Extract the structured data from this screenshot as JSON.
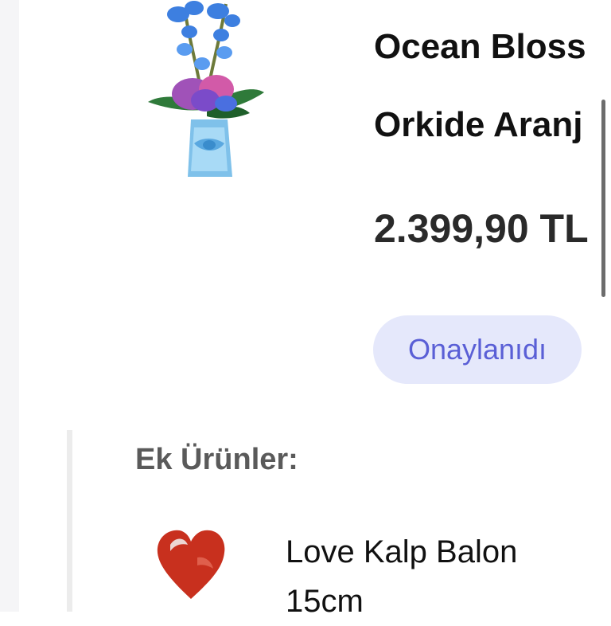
{
  "product": {
    "title_line1": "Ocean Bloss",
    "title_line2": "Orkide Aranj",
    "price": "2.399,90 TL",
    "status": "Onaylanıdı"
  },
  "extras": {
    "heading": "Ek Ürünler:",
    "items": [
      {
        "name": "Love Kalp Balon 15cm"
      }
    ]
  },
  "colors": {
    "badge_bg": "#e5e8fb",
    "badge_text": "#5a5fd6"
  }
}
